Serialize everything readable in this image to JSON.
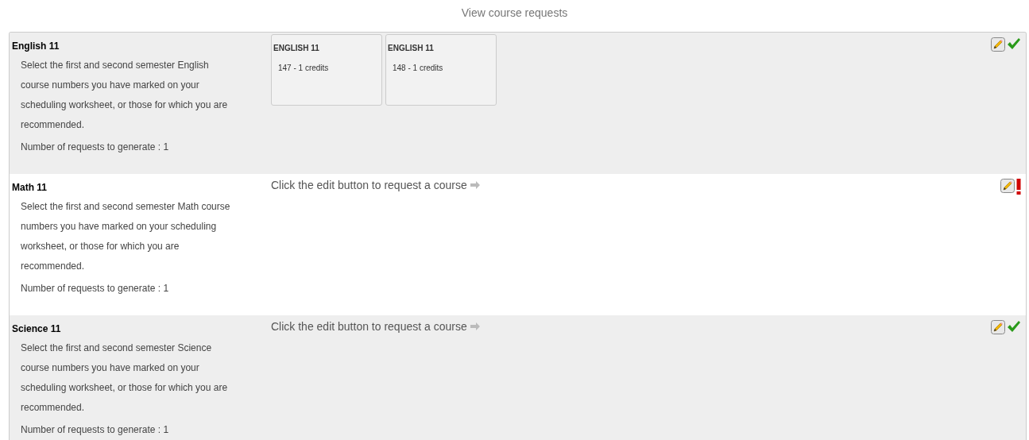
{
  "header_link": "View course requests",
  "requests": [
    {
      "title": "English 11",
      "description": "Select the first and second semester English course numbers you have marked on your scheduling worksheet, or those for which you are recommended.",
      "count": "Number of requests to generate : 1",
      "complete": true,
      "courses": [
        {
          "name": "ENGLISH 11",
          "detail": "147 - 1 credits"
        },
        {
          "name": "ENGLISH 11",
          "detail": "148 - 1 credits"
        }
      ]
    },
    {
      "title": "Math 11",
      "description": "Select the first and second semester Math course numbers you have marked on your scheduling worksheet, or those for which you are recommended.",
      "count": "Number of requests to generate : 1",
      "complete": false,
      "prompt": "Click the edit button to request a course"
    },
    {
      "title": "Science 11",
      "description": "Select the first and second semester Science course numbers you have marked on your scheduling worksheet, or those for which you are recommended.",
      "count": "Number of requests to generate : 1",
      "complete": true,
      "prompt": "Click the edit button to request a course"
    }
  ]
}
